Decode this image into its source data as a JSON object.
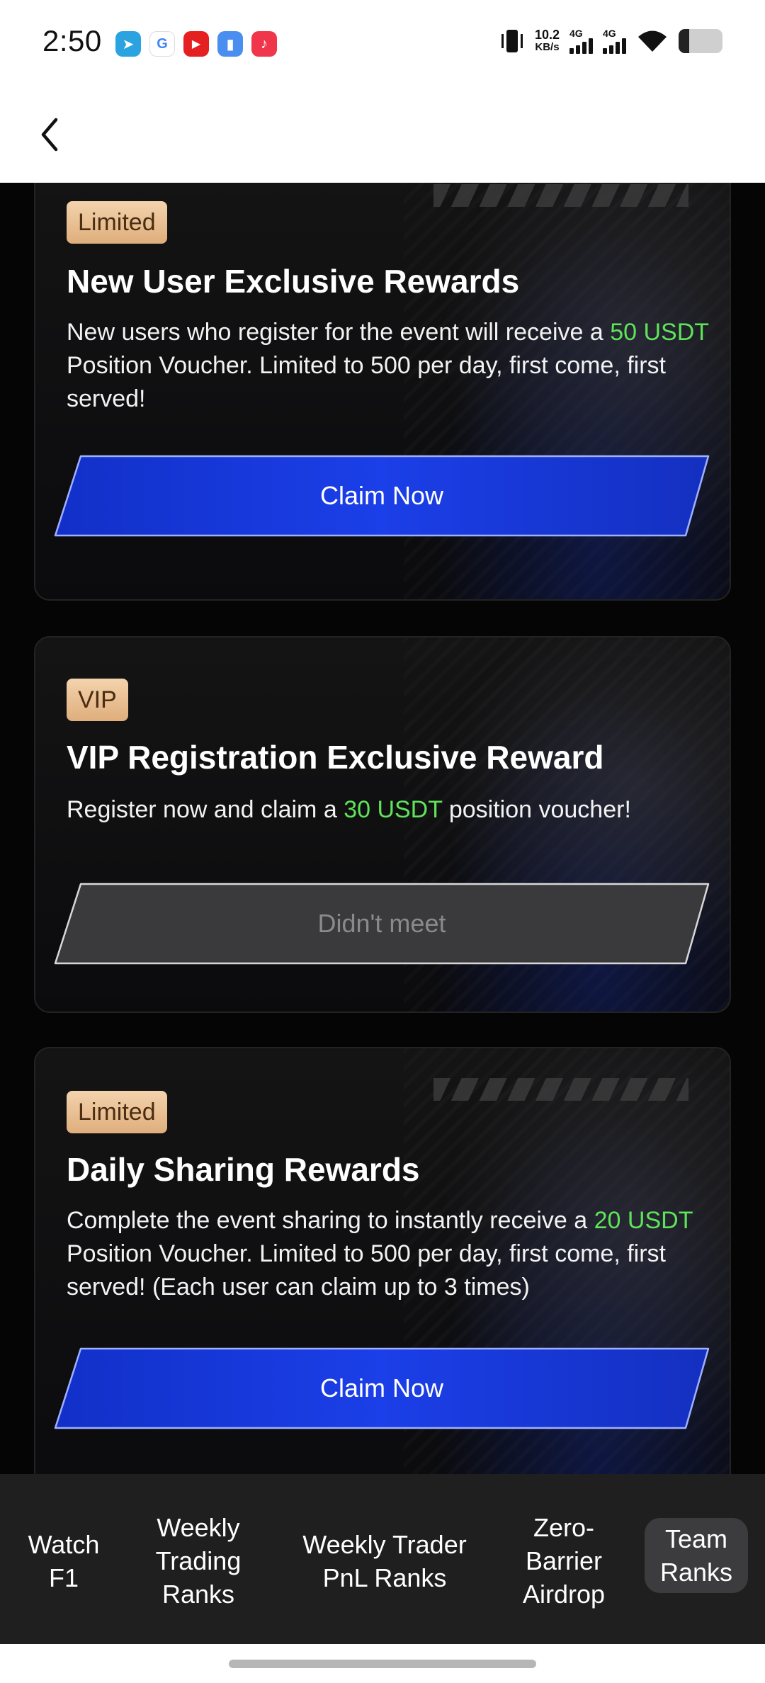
{
  "status_bar": {
    "time": "2:50",
    "apps": [
      {
        "icon": "telegram-icon",
        "glyph": "➤",
        "color": "#2aa3e0"
      },
      {
        "icon": "google-icon",
        "glyph": "G",
        "color": "#ffffff"
      },
      {
        "icon": "youtube-icon",
        "glyph": "▶",
        "color": "#e52020"
      },
      {
        "icon": "files-icon",
        "glyph": "▮",
        "color": "#4a8ff0"
      },
      {
        "icon": "music-icon",
        "glyph": "♪",
        "color": "#f0364a"
      }
    ],
    "net_speed_value": "10.2",
    "net_speed_unit": "KB/s",
    "signal1_label": "4G",
    "signal2_label": "4G"
  },
  "header": {
    "back_icon": "chevron-left-icon"
  },
  "cards": [
    {
      "badge": "Limited",
      "title": "New User Exclusive Rewards",
      "desc_before": "New users who register for the event will receive a ",
      "desc_highlight": "50 USDT",
      "desc_after": " Position Voucher. Limited to 500 per day, first come, first served!",
      "button_label": "Claim Now",
      "button_state": "active"
    },
    {
      "badge": "VIP",
      "title": "VIP Registration Exclusive Reward",
      "desc_before": "Register now and claim a ",
      "desc_highlight": "30 USDT",
      "desc_after": " position voucher!",
      "button_label": "Didn't meet",
      "button_state": "disabled"
    },
    {
      "badge": "Limited",
      "title": "Daily Sharing Rewards",
      "desc_before": "Complete the event sharing to instantly receive a ",
      "desc_highlight": "20 USDT",
      "desc_after": " Position Voucher. Limited to 500 per day, first come, first served! (Each user can claim up to 3 times)",
      "button_label": "Claim Now",
      "button_state": "active"
    }
  ],
  "bottom_nav": {
    "items": [
      {
        "label_line1": "Watch",
        "label_line2": "F1",
        "label_line3": ""
      },
      {
        "label_line1": "Weekly",
        "label_line2": "Trading",
        "label_line3": "Ranks"
      },
      {
        "label_line1": "Weekly Trader",
        "label_line2": "PnL Ranks",
        "label_line3": ""
      },
      {
        "label_line1": "Zero-",
        "label_line2": "Barrier",
        "label_line3": "Airdrop"
      },
      {
        "label_line1": "Team",
        "label_line2": "Ranks",
        "label_line3": ""
      }
    ],
    "active_index": 4
  },
  "colors": {
    "highlight_green": "#5fe35a",
    "button_blue": "#1a3be0",
    "badge_gold": "#e9c095"
  }
}
